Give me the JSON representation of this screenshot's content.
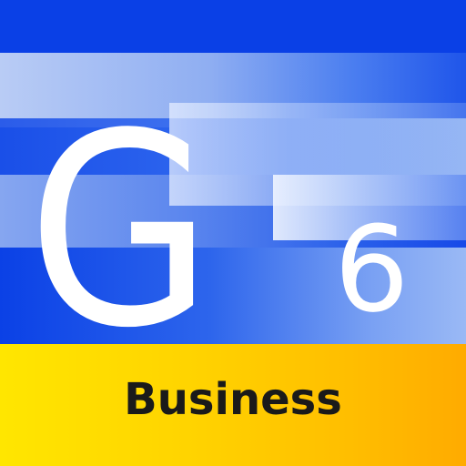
{
  "icon": {
    "letter": "G",
    "version": "6",
    "edition": "Business"
  },
  "colors": {
    "blue": "#0a3fe0",
    "light_blue": "#b9ccf5",
    "yellow": "#ffe600",
    "orange": "#ffab00",
    "text_dark": "#1a1a1a",
    "text_light": "#ffffff"
  }
}
